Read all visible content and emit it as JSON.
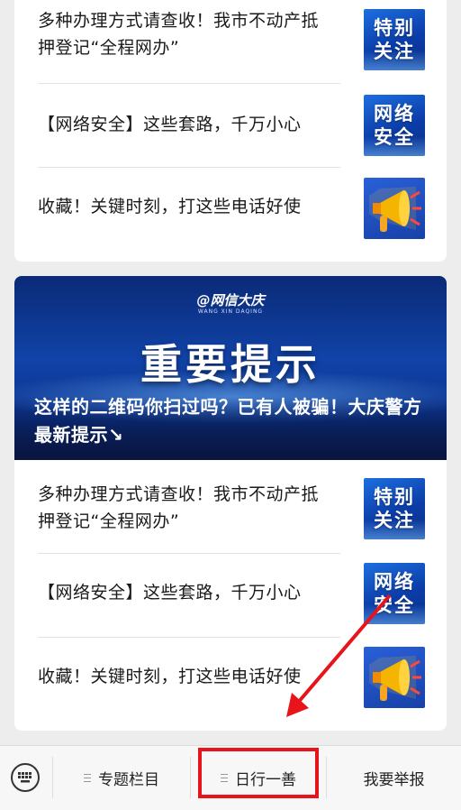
{
  "top_list": [
    {
      "title": "多种办理方式请查收！我市不动产抵押登记“全程网办”",
      "thumb": [
        "特别",
        "关注"
      ]
    },
    {
      "title": "【网络安全】这些套路，千万小心",
      "thumb": [
        "网络",
        "安全"
      ]
    },
    {
      "title": "收藏！关键时刻，打这些电话好使",
      "thumb_icon": "megaphone-icon"
    }
  ],
  "banner": {
    "logo": "@网信大庆",
    "logo_sub": "WANG XIN DAQING",
    "headline": "重要提示",
    "caption": "这样的二维码你扫过吗？已有人被骗！大庆警方最新提示↘"
  },
  "bottom_list": [
    {
      "title": "多种办理方式请查收！我市不动产抵押登记“全程网办”",
      "thumb": [
        "特别",
        "关注"
      ]
    },
    {
      "title": "【网络安全】这些套路，千万小心",
      "thumb": [
        "网络",
        "安全"
      ]
    },
    {
      "title": "收藏！关键时刻，打这些电话好使",
      "thumb_icon": "megaphone-icon"
    }
  ],
  "bottom_bar": {
    "keyboard_icon": "keyboard-icon",
    "menus": [
      "专题栏目",
      "日行一善",
      "我要举报"
    ]
  },
  "colors": {
    "annotation_red": "#e8141c",
    "thumb_blue": "#0b3da8"
  }
}
